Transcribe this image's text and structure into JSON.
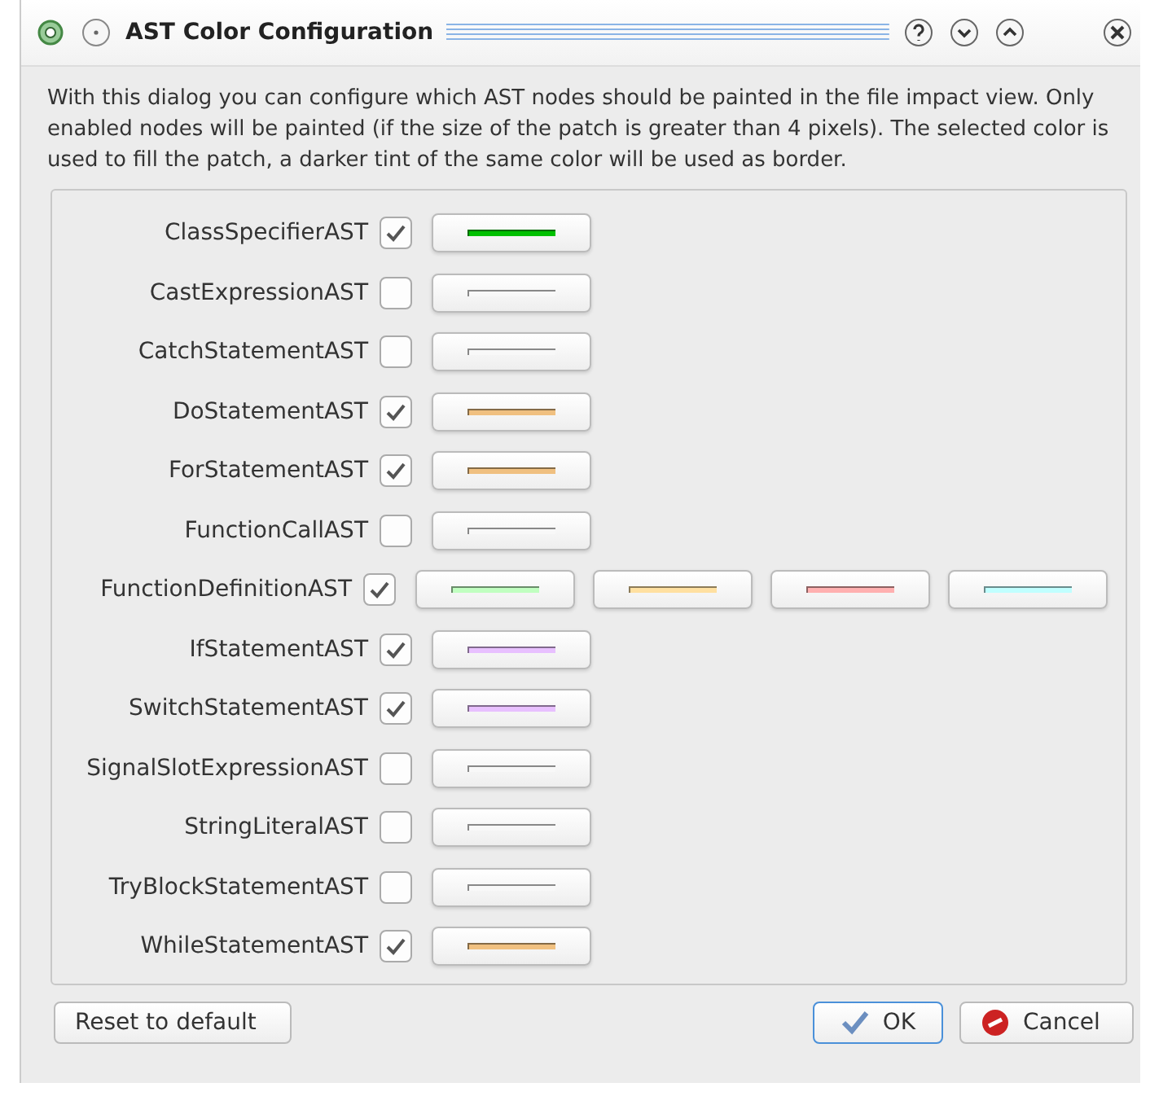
{
  "window": {
    "title": "AST Color Configuration"
  },
  "description": "With this dialog you can configure which AST nodes should be painted in the file impact view. Only enabled nodes will be painted (if the size of the patch is greater than 4 pixels). The selected color is used to fill the patch, a darker tint of the same color will be used as border.",
  "nodes": [
    {
      "name": "ClassSpecifierAST",
      "checked": true,
      "swatches": [
        {
          "color": "#00c000"
        }
      ]
    },
    {
      "name": "CastExpressionAST",
      "checked": false,
      "swatches": [
        {
          "color": "#f8f8f8"
        }
      ]
    },
    {
      "name": "CatchStatementAST",
      "checked": false,
      "swatches": [
        {
          "color": "#f8f8f8"
        }
      ]
    },
    {
      "name": "DoStatementAST",
      "checked": true,
      "swatches": [
        {
          "color": "#f0c080"
        }
      ]
    },
    {
      "name": "ForStatementAST",
      "checked": true,
      "swatches": [
        {
          "color": "#f0c080"
        }
      ]
    },
    {
      "name": "FunctionCallAST",
      "checked": false,
      "swatches": [
        {
          "color": "#f8f8f8"
        }
      ]
    },
    {
      "name": "FunctionDefinitionAST",
      "checked": true,
      "swatches": [
        {
          "color": "#c0ffc0"
        },
        {
          "color": "#ffe0a0"
        },
        {
          "color": "#ffb0b0"
        },
        {
          "color": "#c0ffff"
        }
      ]
    },
    {
      "name": "IfStatementAST",
      "checked": true,
      "swatches": [
        {
          "color": "#e8c0ff"
        }
      ]
    },
    {
      "name": "SwitchStatementAST",
      "checked": true,
      "swatches": [
        {
          "color": "#e8c0ff"
        }
      ]
    },
    {
      "name": "SignalSlotExpressionAST",
      "checked": false,
      "swatches": [
        {
          "color": "#f8f8f8"
        }
      ]
    },
    {
      "name": "StringLiteralAST",
      "checked": false,
      "swatches": [
        {
          "color": "#f8f8f8"
        }
      ]
    },
    {
      "name": "TryBlockStatementAST",
      "checked": false,
      "swatches": [
        {
          "color": "#f8f8f8"
        }
      ]
    },
    {
      "name": "WhileStatementAST",
      "checked": true,
      "swatches": [
        {
          "color": "#f0c080"
        }
      ]
    }
  ],
  "buttons": {
    "reset": "Reset to default",
    "ok": "OK",
    "cancel": "Cancel"
  }
}
